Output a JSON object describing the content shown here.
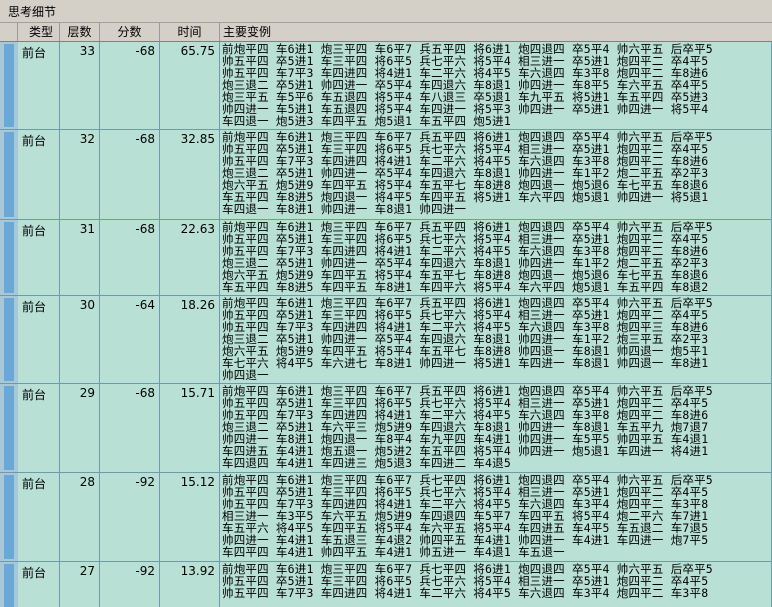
{
  "window": {
    "title": "思考细节"
  },
  "columns": {
    "type": "类型",
    "depth": "层数",
    "score": "分数",
    "time": "时间",
    "variation": "主要变例"
  },
  "rows": [
    {
      "type": "前台",
      "depth": "33",
      "score": "-68",
      "time": "65.75",
      "variation": "前炮平四 车6进1 炮三平四 车6平7 兵五平四 将6进1 炮四退四 卒5平4 帅六平五 后卒平5\n帅五平四 卒5进1 车三平四 将6平5 兵七平六 将5平4 相三进一 卒5进1 炮四平二 卒4平5\n帅五平四 车7平3 车四进四 将4进1 车二平六 将4平5 车六退四 车3平8 炮四平二 车8进6\n炮三退二 卒5进1 帅四进一 卒5平4 车四退六 车8退1 帅四进一 车8平5 车六平五 卒4平5\n炮三平五 车5平6 车五退四 将5平4 车八退三 卒5退1 车九平五 将5进1 车五平四 卒5进3\n帅四进一 车5进1 车五退四 将5平4 车四进一 将5平3 帅四进一 卒5进1 帅四进一 将5平4\n车四退一 炮5进3 车四平五 炮5退1 车五平四 炮5进1"
    },
    {
      "type": "前台",
      "depth": "32",
      "score": "-68",
      "time": "32.85",
      "variation": "前炮平四 车6进1 炮三平四 车6平7 兵五平四 将6进1 炮四退四 卒5平4 帅六平五 后卒平5\n帅五平四 卒5进1 车三平四 将6平5 兵七平六 将5平4 相三进一 卒5进1 炮四平二 卒4平5\n帅五平四 车7平3 车四进四 将4进1 车二平六 将4平5 车六退四 车3平8 炮四平二 车8进6\n炮三退二 卒5进1 帅四进一 卒5平4 车四退六 车8退1 帅四进一 车1平2 炮二平五 卒2平3\n炮六平五 炮5进9 车四平五 将5平4 车五平七 车8进8 炮四退一 炮5退6 车七平五 车8退6\n车五平四 车8进5 炮四退一 将4平5 车四平五 将5进1 车六平四 炮5退1 帅四进一 将5退1\n车四退一 车8进1 帅四进一 车8退1 帅四进一"
    },
    {
      "type": "前台",
      "depth": "31",
      "score": "-68",
      "time": "22.63",
      "variation": "前炮平四 车6进1 炮三平四 车6平7 兵五平四 将6进1 炮四退四 卒5平4 帅六平五 后卒平5\n帅五平四 卒5进1 车三平四 将6平5 兵七平六 将5平4 相三进一 卒5进1 炮四平二 卒4平5\n帅五平四 车7平3 车四进四 将4进1 车二平六 将4平5 车六退四 车3平8 炮四平二 车8进6\n炮三退二 卒5进1 帅四进一 卒5平4 车四退六 车8退1 帅四进一 车1平2 炮二平五 卒2平3\n炮六平五 炮5进9 车四平五 将5平4 车五平七 车8进8 炮四退一 炮5退6 车七平五 车8退6\n车五平四 车8进5 车四平五 车8进1 车四平六 将5平4 车六平四 炮5退1 车五平四 车8退2"
    },
    {
      "type": "前台",
      "depth": "30",
      "score": "-64",
      "time": "18.26",
      "variation": "前炮平四 车6进1 炮三平四 车6平7 兵五平四 将6进1 炮四退四 卒5平4 帅六平五 后卒平5\n帅五平四 卒5进1 车三平四 将6平5 兵七平六 将5平4 相三进一 卒5进1 炮四平二 卒4平5\n帅五平四 车7平3 车四进四 将4进1 车二平六 将4平5 车六退四 车3平8 炮四平三 车8进6\n炮三退二 卒5进1 帅四进一 卒5平4 车四退六 车8退1 帅四进一 车1平2 炮三平五 卒2平3\n炮六平五 炮5进9 车四平五 将5平4 车五平七 车8进8 帅四退一 车8退1 帅四退一 炮5平1\n车七平六 将4平5 车六进七 车8进1 帅四进一 将5进1 车四进一 车8退1 帅四退一 车8进1\n帅四退一"
    },
    {
      "type": "前台",
      "depth": "29",
      "score": "-68",
      "time": "15.71",
      "variation": "前炮平四 车6进1 炮三平四 车6平7 兵五平四 将6进1 炮四退四 卒5平4 帅六平五 后卒平5\n帅五平四 卒5进1 车三平四 将6平5 兵七平六 将5平4 相三进一 卒5进1 炮四平二 卒4平5\n帅五平四 车7平3 车四进四 将4进1 车二平六 将4平5 车六退四 车3平8 炮四平二 车8进6\n炮三退二 卒5进1 车六平三 炮5进9 车四退六 车8退1 帅四进一 车8退1 车五平九 炮7退7\n帅四进一 车8进1 炮四退一 车8平4 车九平四 车4进1 帅四进一 车5平5 帅四平五 车4退1\n车四进五 车4进1 炮五退一 炮5进2 车五平四 将5平4 帅四进一 炮5退1 车四进一 将4进1\n车四退四 车4进1 车四进三 炮5退3 车四进二 车4退5"
    },
    {
      "type": "前台",
      "depth": "28",
      "score": "-92",
      "time": "15.12",
      "variation": "前炮平四 车6进1 炮三平四 车6平7 兵七平四 将6进1 炮四退四 卒5平4 帅六平五 后卒平5\n帅五平四 卒5进1 车三平四 将6平5 兵七平六 将5平4 相三进一 卒5进1 炮四平二 卒4平5\n帅五平四 车7平3 车四进四 将4进1 车二平六 将4平5 车六退四 车3平4 炮四平二 车3平8\n相三进一 车3平5 车六平五 炮5进9 车四退四 车5平7 车四平五 将5平4 炮二平六 车7进1\n车五平六 将4平5 车四平五 将5平4 车六平五 将5平4 车四进五 车4平5 车五退二 车7退5\n帅四进一 车4进1 车五退三 车4退2 帅四平五 车4进1 帅四进一 车4进1 车四进一 炮7平5\n车四平四 车4进1 帅四平五 车4进1 帅五进一 车4退1 车五退一"
    },
    {
      "type": "前台",
      "depth": "27",
      "score": "-92",
      "time": "13.92",
      "variation": "前炮平四 车6进1 炮三平四 车6平7 兵七平四 将6进1 炮四退四 卒5平4 帅六平五 后卒平5\n帅五平四 卒5进1 车三平四 将6平5 兵七平六 将5平4 相三进一 卒5进1 炮四平二 卒4平5\n帅五平四 车7平3 车四进四 将4进1 车二平六 将4平5 车六退四 车3平4 炮四平二 车3平8"
    }
  ]
}
